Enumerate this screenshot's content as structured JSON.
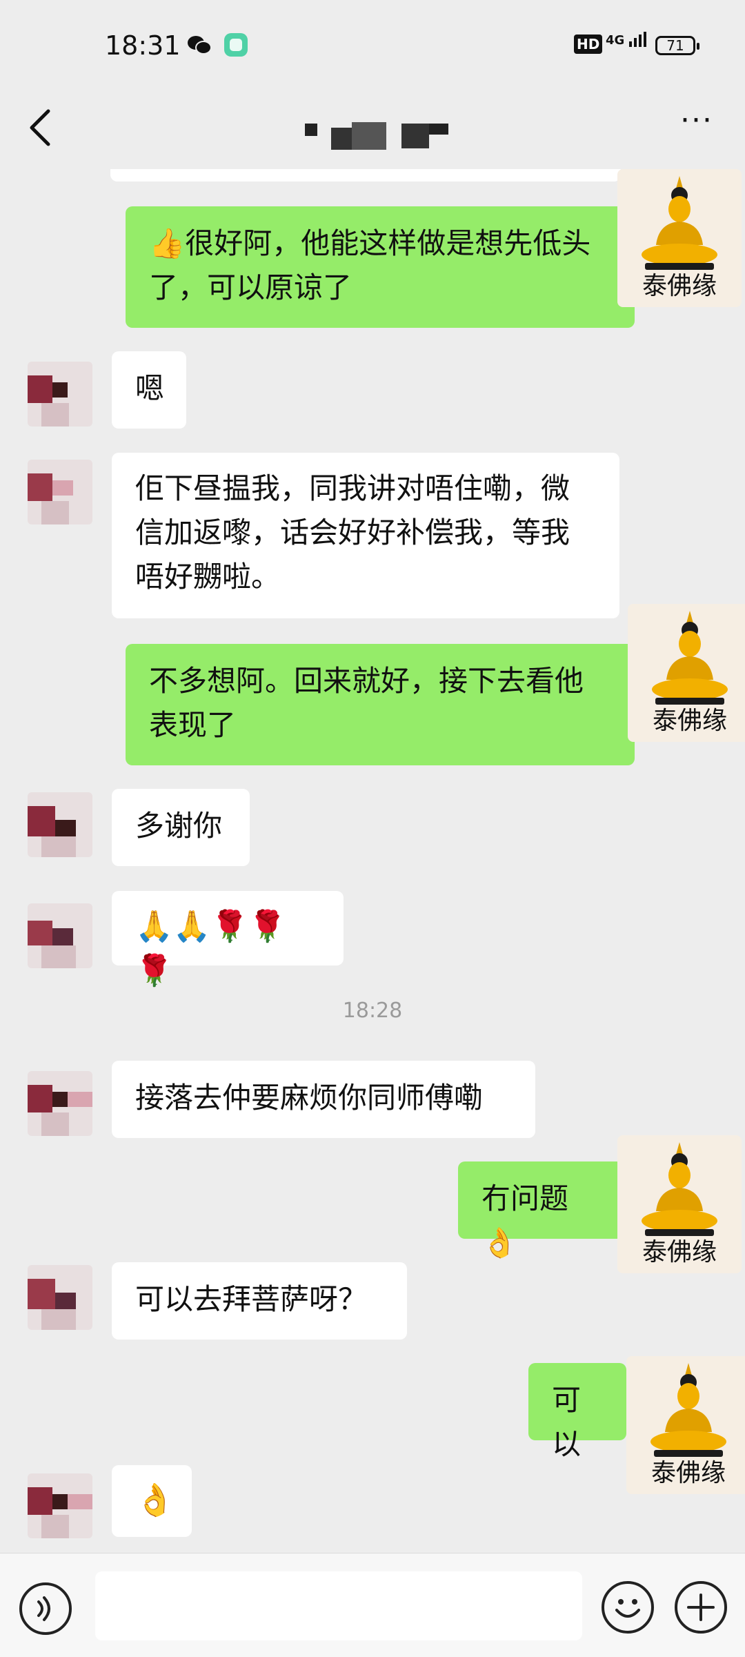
{
  "status_bar": {
    "time": "18:31",
    "network": "4G",
    "hd": "HD",
    "battery": "71",
    "icons": [
      "wechat-icon",
      "app-icon",
      "hd-icon",
      "signal-icon",
      "battery-icon"
    ]
  },
  "nav": {
    "back_icon": "chevron-left-icon",
    "title": "",
    "more_icon": "more-icon"
  },
  "outgoing_avatar_caption": "泰佛缘",
  "messages": [
    {
      "side": "out",
      "text": "👍很好阿，他能这样做是想先低头了，可以原谅了"
    },
    {
      "side": "in",
      "text": "嗯"
    },
    {
      "side": "in",
      "text": "佢下昼揾我，同我讲对唔住嘞，微信加返嚟，话会好好补偿我，等我唔好嬲啦。"
    },
    {
      "side": "out",
      "text": "不多想阿。回来就好，接下去看他表现了"
    },
    {
      "side": "in",
      "text": "多谢你"
    },
    {
      "side": "in",
      "text": "🙏🙏🌹🌹🌹"
    },
    {
      "type": "time",
      "text": "18:28"
    },
    {
      "side": "in",
      "text": "接落去仲要麻烦你同师傅嘞"
    },
    {
      "side": "out",
      "text": "冇问题👌"
    },
    {
      "side": "in",
      "text": "可以去拜菩萨呀？"
    },
    {
      "side": "out",
      "text": "可以"
    },
    {
      "side": "in",
      "text": "👌"
    }
  ],
  "input_bar": {
    "voice_icon": "voice-icon",
    "emoji_icon": "smile-icon",
    "plus_icon": "plus-icon",
    "text_value": ""
  },
  "colors": {
    "background": "#ededed",
    "incoming_bubble": "#ffffff",
    "outgoing_bubble": "#95ec69"
  }
}
